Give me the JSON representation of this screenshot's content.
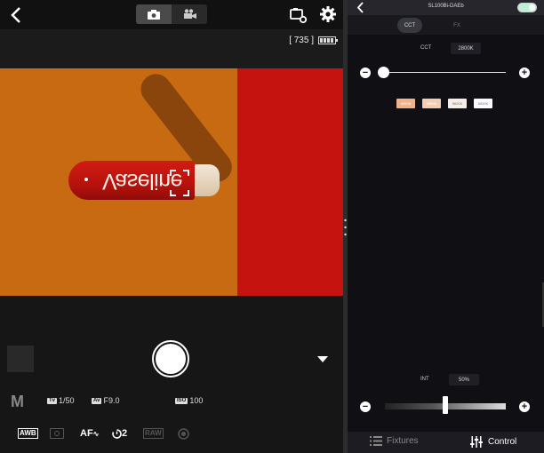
{
  "camera": {
    "shots_remaining": "[ 735 ]",
    "mode": "M",
    "tv_badge": "Tv",
    "shutter_speed": "1/50",
    "av_badge": "Av",
    "aperture": "F9.0",
    "iso_badge": "ISO",
    "iso": "100",
    "white_balance": "AWB",
    "af_label": "AF",
    "drive": "2",
    "raw_label": "RAW",
    "scene_brand_text": "Vaseline",
    "icons": [
      "chevron-left-icon",
      "camera-icon",
      "video-camera-icon",
      "camera-settings-icon",
      "gear-icon",
      "battery-icon",
      "shutter-icon",
      "expand-arrow-icon",
      "metering-icon",
      "self-timer-icon",
      "raw-icon",
      "circle-icon"
    ]
  },
  "control": {
    "device_name": "SL100Bi-DAEb",
    "tabs": [
      "CCT",
      "FX"
    ],
    "active_tab": "CCT",
    "cct_label": "CCT",
    "cct_value": "2800K",
    "cct_level": 0.0,
    "presets": [
      "3200K",
      "4300K",
      "5600K",
      "6500K"
    ],
    "int_label": "INT",
    "int_value": "50%",
    "int_level": 0.5,
    "power_on": true,
    "nav": {
      "fixtures": "Fixtures",
      "control": "Control"
    },
    "colors": {
      "accent_on": "#bff0d5",
      "panel_bg": "#101014"
    }
  }
}
